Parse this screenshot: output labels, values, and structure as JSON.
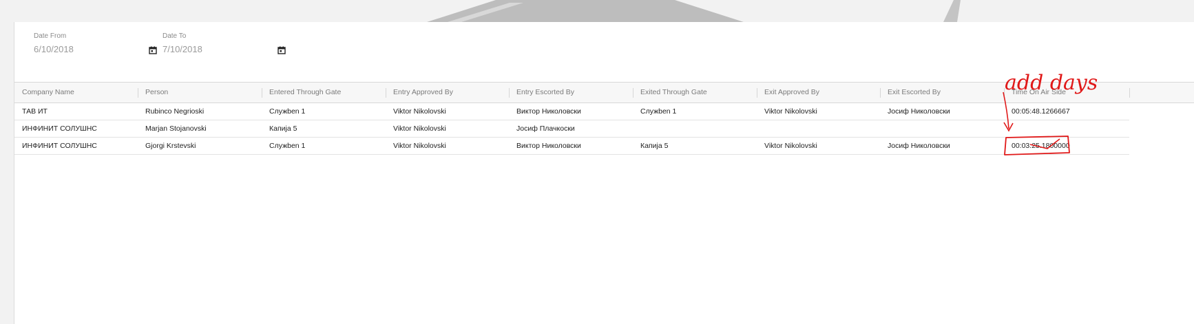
{
  "filters": {
    "date_from": {
      "label": "Date From",
      "value": "6/10/2018"
    },
    "date_to": {
      "label": "Date To",
      "value": "7/10/2018"
    }
  },
  "table": {
    "columns": [
      "Company Name",
      "Person",
      "Entered Through Gate",
      "Entry Approved By",
      "Entry Escorted By",
      "Exited Through Gate",
      "Exit Approved By",
      "Exit Escorted By",
      "Time On Air Side"
    ],
    "rows": [
      [
        "ТАВ ИТ",
        "Rubinco Negrioski",
        "Служben 1",
        "Viktor Nikolovski",
        "Виктор Николовски",
        "Служben 1",
        "Viktor Nikolovski",
        "Јосиф Николовски",
        "00:05:48.1266667"
      ],
      [
        "ИНФИНИТ СОЛУШНС",
        "Marjan Stojanovski",
        "Капија 5",
        "Viktor Nikolovski",
        "Јосиф Плачкоски",
        "",
        "",
        "",
        ""
      ],
      [
        "ИНФИНИТ СОЛУШНС",
        "Gjorgi Krstevski",
        "Служben 1",
        "Viktor Nikolovski",
        "Виктор Николовски",
        "Капија 5",
        "Viktor Nikolovski",
        "Јосиф Николовски",
        "00:03:25.1800000"
      ]
    ]
  },
  "annotation": {
    "text": "add days",
    "color": "#e01818"
  },
  "icons": {
    "calendar": "calendar-icon"
  }
}
